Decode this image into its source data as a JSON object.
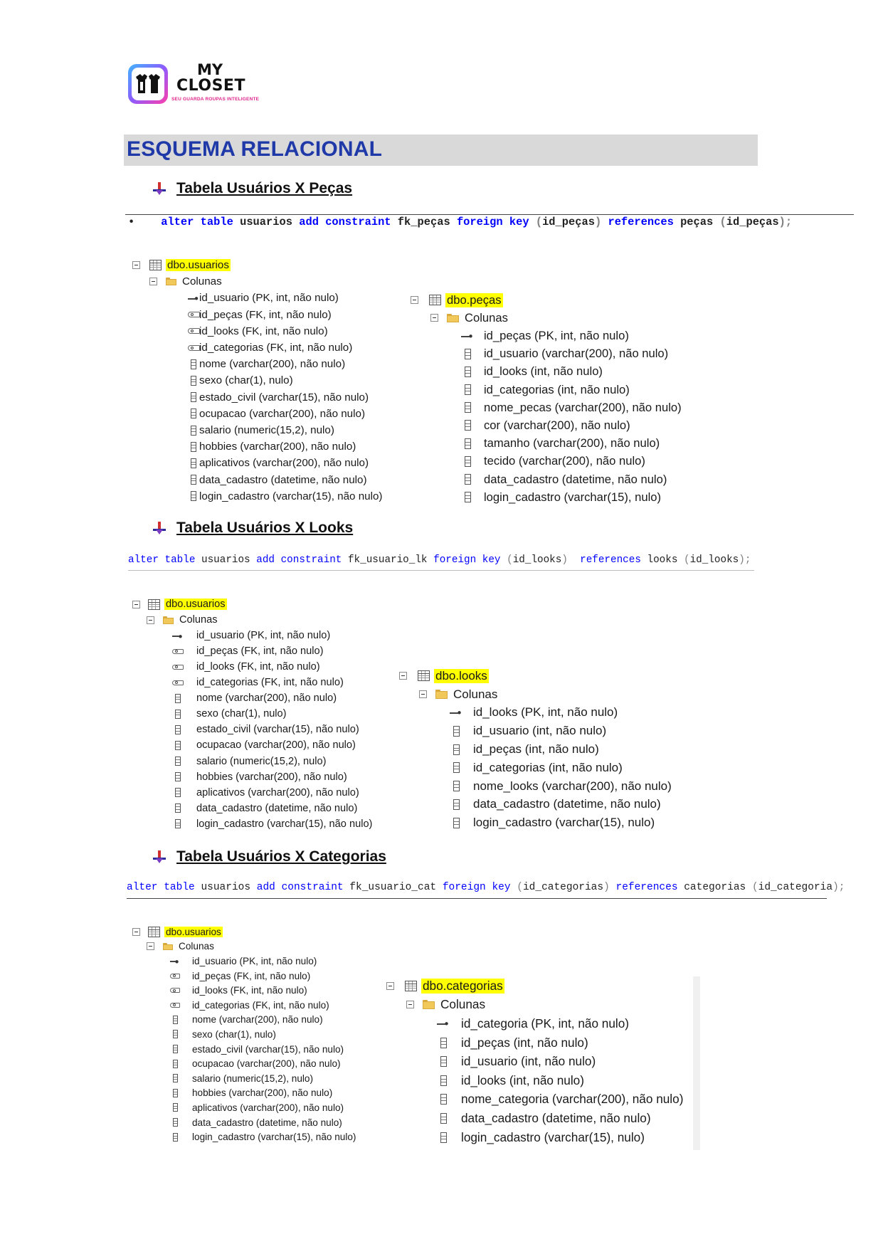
{
  "logo": {
    "line1": "MY",
    "line2": "CLOSET",
    "tagline": "SEU GUARDA ROUPAS INTELIGENTE",
    "colors": {
      "gradient_start": "#3fb6ff",
      "gradient_mid": "#8d5bff",
      "gradient_end": "#ff3fa8",
      "tagline": "#e0258c"
    }
  },
  "section": {
    "title": "ESQUEMA RELACIONAL",
    "title_color": "#1f3aa8",
    "bar_color": "#d9d9d9"
  },
  "colors": {
    "highlight": "#ffff00",
    "sql_keyword": "#0000ff",
    "sql_paren": "#7f7f7f"
  },
  "blocks": [
    {
      "heading": "Tabela Usuários X Peças",
      "sql": {
        "bullet": "•",
        "alter": "alter",
        "table": "table",
        "table_name": "usuarios",
        "add": "add",
        "constraint": "constraint",
        "constraint_name": "fk_peças",
        "foreign": "foreign",
        "key": "key",
        "open1": "(",
        "col": "id_peças",
        "close1": ")",
        "references": "references",
        "ref_table": "peças",
        "open2": "(",
        "ref_col": "id_peças",
        "close2": ");"
      },
      "left": {
        "table": "dbo.usuarios",
        "folder": "Colunas",
        "columns": [
          {
            "icon": "pk",
            "text": "id_usuario (PK, int, não nulo)"
          },
          {
            "icon": "fk",
            "text": "id_peças (FK, int, não nulo)"
          },
          {
            "icon": "fk",
            "text": "id_looks (FK, int, não nulo)"
          },
          {
            "icon": "fk",
            "text": "id_categorias (FK, int, não nulo)"
          },
          {
            "icon": "col",
            "text": "nome (varchar(200), não nulo)"
          },
          {
            "icon": "col",
            "text": "sexo (char(1), nulo)"
          },
          {
            "icon": "col",
            "text": "estado_civil (varchar(15), não nulo)"
          },
          {
            "icon": "col",
            "text": "ocupacao (varchar(200), não nulo)"
          },
          {
            "icon": "col",
            "text": "salario (numeric(15,2), nulo)"
          },
          {
            "icon": "col",
            "text": "hobbies (varchar(200), não nulo)"
          },
          {
            "icon": "col",
            "text": "aplicativos (varchar(200), não nulo)"
          },
          {
            "icon": "col",
            "text": "data_cadastro (datetime, não nulo)"
          },
          {
            "icon": "col",
            "text": "login_cadastro (varchar(15), não nulo)"
          }
        ]
      },
      "right": {
        "table": "dbo.peças",
        "folder": "Colunas",
        "columns": [
          {
            "icon": "pk",
            "text": "id_peças (PK, int, não nulo)"
          },
          {
            "icon": "col",
            "text": "id_usuario (varchar(200), não nulo)"
          },
          {
            "icon": "col",
            "text": "id_looks (int, não nulo)"
          },
          {
            "icon": "col",
            "text": "id_categorias (int, não nulo)"
          },
          {
            "icon": "col",
            "text": "nome_pecas (varchar(200), não nulo)"
          },
          {
            "icon": "col",
            "text": "cor (varchar(200), não nulo)"
          },
          {
            "icon": "col",
            "text": "tamanho (varchar(200), não nulo)"
          },
          {
            "icon": "col",
            "text": "tecido (varchar(200), não nulo)"
          },
          {
            "icon": "col",
            "text": "data_cadastro (datetime, não nulo)"
          },
          {
            "icon": "col",
            "text": "login_cadastro (varchar(15), nulo)"
          }
        ]
      }
    },
    {
      "heading": "Tabela Usuários X Looks",
      "sql": {
        "alter": "alter",
        "table": "table",
        "table_name": "usuarios",
        "add": "add",
        "constraint": "constraint",
        "constraint_name": "fk_usuario_lk",
        "foreign": "foreign",
        "key": "key",
        "open1": "(",
        "col": "id_looks",
        "close1": ")",
        "references": "references",
        "ref_table": "looks",
        "open2": "(",
        "ref_col": "id_looks",
        "close2": ");"
      },
      "left": {
        "table": "dbo.usuarios",
        "folder": "Colunas",
        "columns": [
          {
            "icon": "pk",
            "text": "id_usuario (PK, int, não nulo)"
          },
          {
            "icon": "fk",
            "text": "id_peças (FK, int, não nulo)"
          },
          {
            "icon": "fk",
            "text": "id_looks (FK, int, não nulo)"
          },
          {
            "icon": "fk",
            "text": "id_categorias (FK, int, não nulo)"
          },
          {
            "icon": "col",
            "text": "nome (varchar(200), não nulo)"
          },
          {
            "icon": "col",
            "text": "sexo (char(1), nulo)"
          },
          {
            "icon": "col",
            "text": "estado_civil (varchar(15), não nulo)"
          },
          {
            "icon": "col",
            "text": "ocupacao (varchar(200), não nulo)"
          },
          {
            "icon": "col",
            "text": "salario (numeric(15,2), nulo)"
          },
          {
            "icon": "col",
            "text": "hobbies (varchar(200), não nulo)"
          },
          {
            "icon": "col",
            "text": "aplicativos (varchar(200), não nulo)"
          },
          {
            "icon": "col",
            "text": "data_cadastro (datetime, não nulo)"
          },
          {
            "icon": "col",
            "text": "login_cadastro (varchar(15), não nulo)"
          }
        ]
      },
      "right": {
        "table": "dbo.looks",
        "folder": "Colunas",
        "columns": [
          {
            "icon": "pk",
            "text": "id_looks (PK, int, não nulo)"
          },
          {
            "icon": "col",
            "text": "id_usuario (int, não nulo)"
          },
          {
            "icon": "col",
            "text": "id_peças (int, não nulo)"
          },
          {
            "icon": "col",
            "text": "id_categorias (int, não nulo)"
          },
          {
            "icon": "col",
            "text": "nome_looks (varchar(200), não nulo)"
          },
          {
            "icon": "col",
            "text": "data_cadastro (datetime, não nulo)"
          },
          {
            "icon": "col",
            "text": "login_cadastro (varchar(15), nulo)"
          }
        ]
      }
    },
    {
      "heading": "Tabela Usuários X Categorias",
      "sql": {
        "alter": "alter",
        "table": "table",
        "table_name": "usuarios",
        "add": "add",
        "constraint": "constraint",
        "constraint_name": "fk_usuario_cat",
        "foreign": "foreign",
        "key": "key",
        "open1": "(",
        "col": "id_categorias",
        "close1": ")",
        "references": "references",
        "ref_table": "categorias",
        "open2": "(",
        "ref_col": "id_categoria",
        "close2": ");"
      },
      "left": {
        "table": "dbo.usuarios",
        "folder": "Colunas",
        "columns": [
          {
            "icon": "pk",
            "text": "id_usuario (PK, int, não nulo)"
          },
          {
            "icon": "fk",
            "text": "id_peças (FK, int, não nulo)"
          },
          {
            "icon": "fk",
            "text": "id_looks (FK, int, não nulo)"
          },
          {
            "icon": "fk",
            "text": "id_categorias (FK, int, não nulo)"
          },
          {
            "icon": "col",
            "text": "nome (varchar(200), não nulo)"
          },
          {
            "icon": "col",
            "text": "sexo (char(1), nulo)"
          },
          {
            "icon": "col",
            "text": "estado_civil (varchar(15), não nulo)"
          },
          {
            "icon": "col",
            "text": "ocupacao (varchar(200), não nulo)"
          },
          {
            "icon": "col",
            "text": "salario (numeric(15,2), nulo)"
          },
          {
            "icon": "col",
            "text": "hobbies (varchar(200), não nulo)"
          },
          {
            "icon": "col",
            "text": "aplicativos (varchar(200), não nulo)"
          },
          {
            "icon": "col",
            "text": "data_cadastro (datetime, não nulo)"
          },
          {
            "icon": "col",
            "text": "login_cadastro (varchar(15), não nulo)"
          }
        ]
      },
      "right": {
        "table": "dbo.categorias",
        "folder": "Colunas",
        "columns": [
          {
            "icon": "pk",
            "text": "id_categoria (PK, int, não nulo)"
          },
          {
            "icon": "col",
            "text": "id_peças (int, não nulo)"
          },
          {
            "icon": "col",
            "text": "id_usuario (int, não nulo)"
          },
          {
            "icon": "col",
            "text": "id_looks (int, não nulo)"
          },
          {
            "icon": "col",
            "text": "nome_categoria (varchar(200), não nulo)"
          },
          {
            "icon": "col",
            "text": "data_cadastro (datetime, não nulo)"
          },
          {
            "icon": "col",
            "text": "login_cadastro (varchar(15), nulo)"
          }
        ]
      }
    }
  ]
}
